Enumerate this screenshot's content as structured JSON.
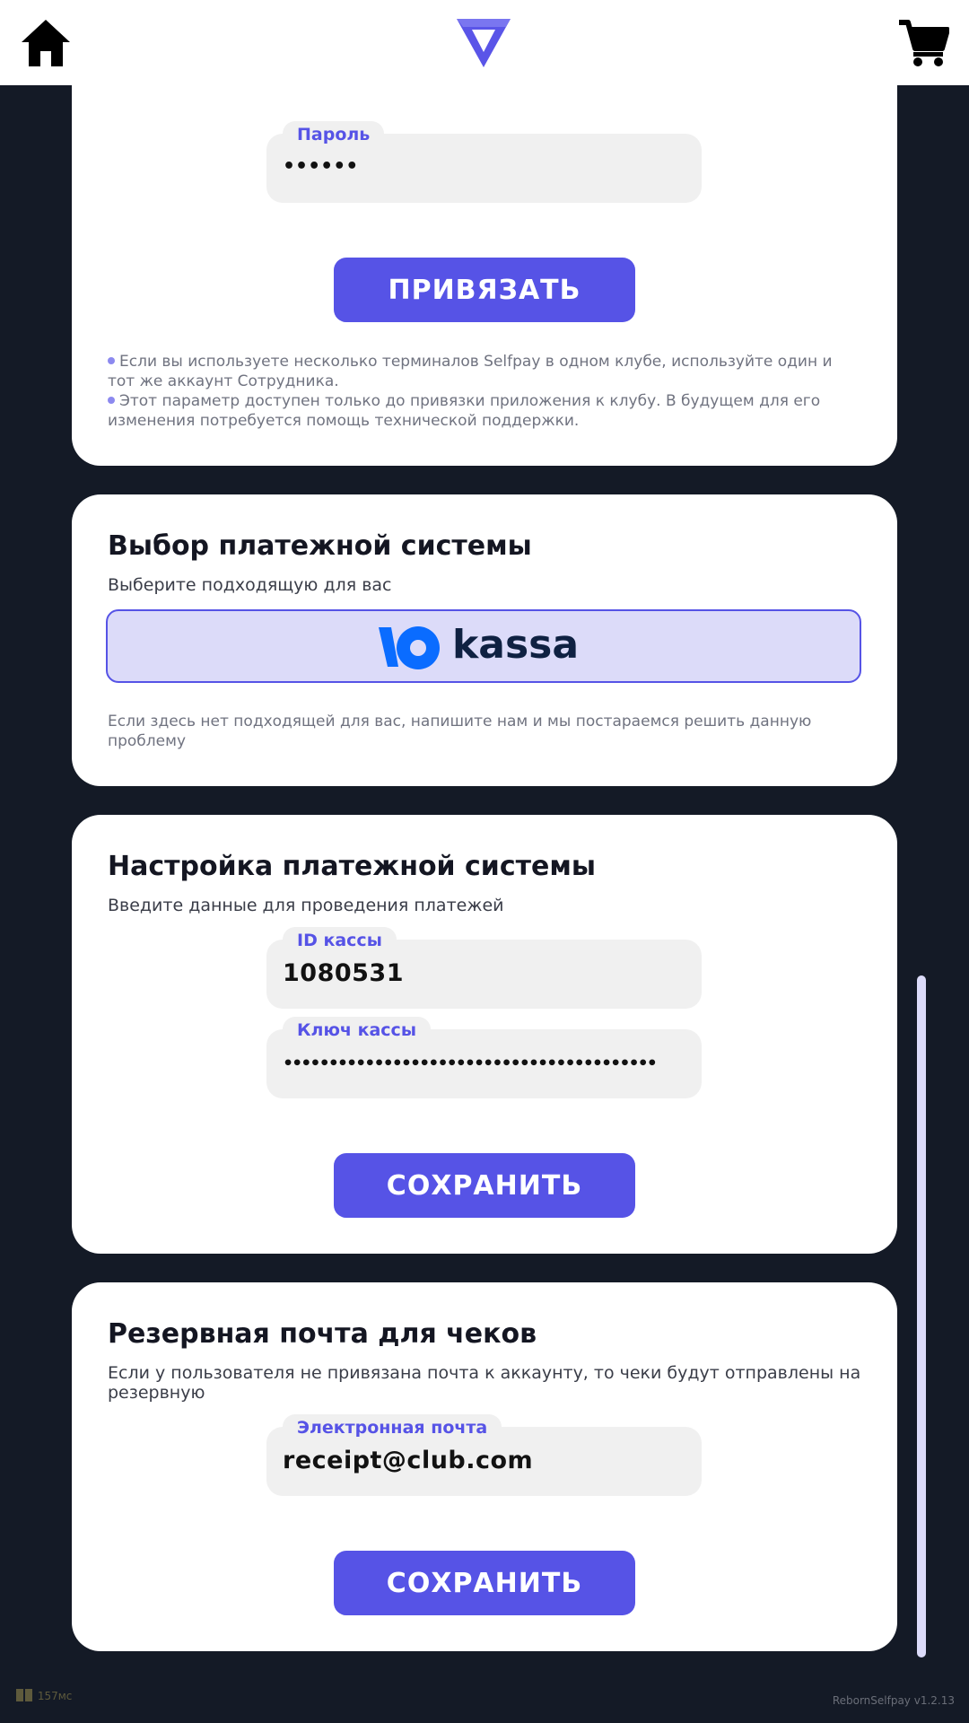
{
  "header": {
    "home_icon": "home-icon",
    "logo_icon": "app-logo-icon",
    "cart_icon": "shopping-cart-icon"
  },
  "account_card": {
    "password_label": "Пароль",
    "password_value": "••••••",
    "bind_button": "ПРИВЯЗАТЬ",
    "notes": [
      "Если вы используете несколько терминалов Selfpay в одном клубе, используйте один и тот же аккаунт Сотрудника.",
      "Этот параметр доступен только до привязки приложения к клубу. В будущем для его изменения потребуется помощь технической поддержки."
    ]
  },
  "payment_choice": {
    "title": "Выбор платежной системы",
    "subtitle": "Выберите подходящую для вас",
    "option_text": "kassa",
    "hint": "Если здесь нет подходящей для вас, напишите нам и мы постараемся решить данную проблему"
  },
  "payment_setup": {
    "title": "Настройка платежной системы",
    "subtitle": "Введите данные для проведения платежей",
    "kassa_id_label": "ID кассы",
    "kassa_id_value": "1080531",
    "kassa_key_label": "Ключ кассы",
    "kassa_key_value": "•••••••••••••••••••••••••••••••••••••••••",
    "save_button": "СОХРАНИТЬ"
  },
  "receipt_email": {
    "title": "Резервная почта для чеков",
    "subtitle": "Если у пользователя не привязана почта к аккаунту, то чеки будут отправлены на резервную",
    "email_label": "Электронная почта",
    "email_value": "receipt@club.com",
    "save_button": "СОХРАНИТЬ"
  },
  "footer": {
    "ping": "157мс",
    "version": "RebornSelfpay v1.2.13"
  },
  "colors": {
    "accent": "#5653e6",
    "background": "#141a26",
    "selected_option_bg": "#dcdbf9",
    "yookassa_blue": "#0a6cff"
  }
}
